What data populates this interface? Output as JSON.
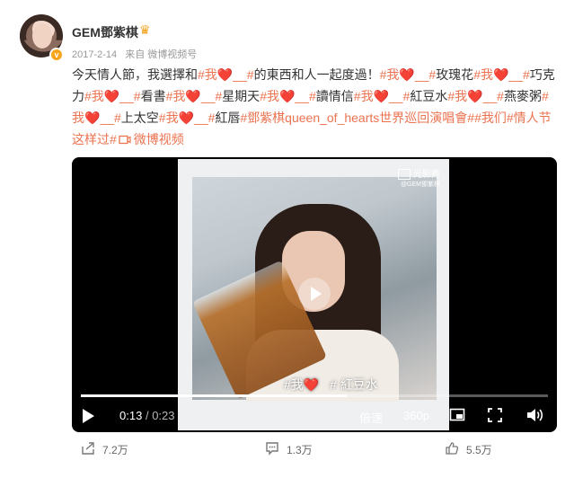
{
  "post": {
    "username": "GEM鄧紫棋",
    "date": "2017-2-14",
    "source": "来自 微博视频号",
    "text_intro": "今天情人節，我選擇和",
    "tag_me": "#我",
    "tag_blank": "__#",
    "heart": "❤️",
    "text_things": "的東西和人一起度過！",
    "word_rose": "玫瑰花",
    "word_choc": "巧克力",
    "word_book": "看書",
    "word_sunday": "星期天",
    "word_letter": "讀情信",
    "word_redbean": "紅豆水",
    "word_oats": "燕麥粥",
    "word_space": "上太空",
    "word_lips": "紅唇",
    "tag_tour": "#鄧紫棋queen_of_hearts世界巡回演唱會#",
    "tag_valentine": "#我们#情人节这样过#",
    "video_link": "微博视频"
  },
  "video": {
    "brand_name": "光影秀",
    "brand_handle": "@GEM鄧紫棋",
    "caption_tag": "#我",
    "caption_text": "紅豆水",
    "current_time": "0:13",
    "separator": "/",
    "duration": "0:23",
    "progress_fraction": 0.57,
    "speed_label": "倍速",
    "quality_label": "360p"
  },
  "actions": {
    "repost_count": "7.2万",
    "comment_count": "1.3万",
    "like_count": "5.5万"
  },
  "colors": {
    "accent": "#eb7350",
    "heart": "#e8383d",
    "verified": "#f7a51c"
  },
  "icons": {
    "crown": "crown-icon",
    "verified": "verified-badge-icon",
    "play": "play-icon",
    "repost": "repost-icon",
    "comment": "comment-icon",
    "like": "like-icon"
  }
}
